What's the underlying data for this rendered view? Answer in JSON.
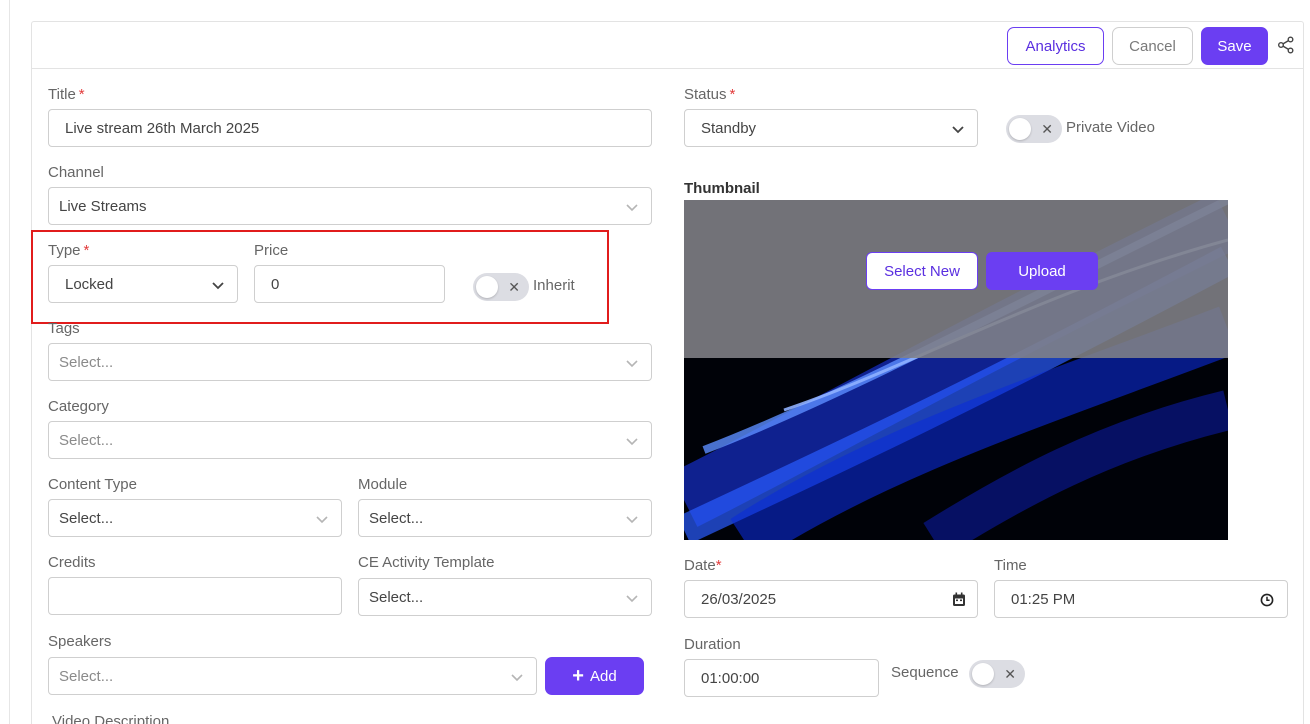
{
  "header": {
    "analytics_label": "Analytics",
    "cancel_label": "Cancel",
    "save_label": "Save",
    "share_icon": "share-icon"
  },
  "form": {
    "title": {
      "label": "Title",
      "required": "*",
      "value": "Live stream 26th March 2025"
    },
    "status": {
      "label": "Status",
      "required": "*",
      "value": "Standby"
    },
    "private_video": {
      "label": "Private Video",
      "on": false
    },
    "channel": {
      "label": "Channel",
      "value": "Live Streams"
    },
    "thumbnail": {
      "label": "Thumbnail",
      "select_new_label": "Select New",
      "upload_label": "Upload"
    },
    "type": {
      "label": "Type",
      "required": "*",
      "value": "Locked"
    },
    "price": {
      "label": "Price",
      "value": "0"
    },
    "inherit": {
      "label": "Inherit",
      "on": false
    },
    "tags": {
      "label": "Tags",
      "placeholder": "Select..."
    },
    "category": {
      "label": "Category",
      "placeholder": "Select..."
    },
    "content_type": {
      "label": "Content Type",
      "placeholder": "Select..."
    },
    "module": {
      "label": "Module",
      "placeholder": "Select..."
    },
    "credits": {
      "label": "Credits",
      "value": ""
    },
    "ce_activity_template": {
      "label": "CE Activity Template",
      "placeholder": "Select..."
    },
    "speakers": {
      "label": "Speakers",
      "placeholder": "Select...",
      "add_label": "Add"
    },
    "video_description": {
      "label": "Video Description"
    },
    "date": {
      "label": "Date",
      "required": "*",
      "value": "26/03/2025"
    },
    "time": {
      "label": "Time",
      "value": "01:25 PM"
    },
    "duration": {
      "label": "Duration",
      "value": "01:00:00"
    },
    "sequence": {
      "label": "Sequence",
      "on": false
    }
  },
  "colors": {
    "accent": "#6b3ef2",
    "required": "#e23a3a",
    "highlight": "#e11c1c"
  }
}
